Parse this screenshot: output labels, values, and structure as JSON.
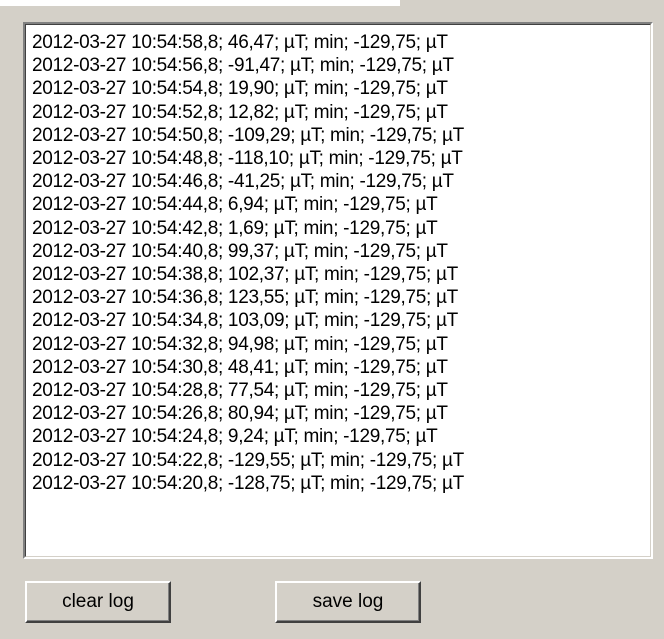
{
  "log": {
    "lines": [
      "2012-03-27 10:54:58,8; 46,47; µT; min; -129,75; µT",
      "2012-03-27 10:54:56,8; -91,47; µT; min; -129,75; µT",
      "2012-03-27 10:54:54,8; 19,90; µT; min; -129,75; µT",
      "2012-03-27 10:54:52,8; 12,82; µT; min; -129,75; µT",
      "2012-03-27 10:54:50,8; -109,29; µT; min; -129,75; µT",
      "2012-03-27 10:54:48,8; -118,10; µT; min; -129,75; µT",
      "2012-03-27 10:54:46,8; -41,25; µT; min; -129,75; µT",
      "2012-03-27 10:54:44,8; 6,94; µT; min; -129,75; µT",
      "2012-03-27 10:54:42,8; 1,69; µT; min; -129,75; µT",
      "2012-03-27 10:54:40,8; 99,37; µT; min; -129,75; µT",
      "2012-03-27 10:54:38,8; 102,37; µT; min; -129,75; µT",
      "2012-03-27 10:54:36,8; 123,55; µT; min; -129,75; µT",
      "2012-03-27 10:54:34,8; 103,09; µT; min; -129,75; µT",
      "2012-03-27 10:54:32,8; 94,98; µT; min; -129,75; µT",
      "2012-03-27 10:54:30,8; 48,41; µT; min; -129,75; µT",
      "2012-03-27 10:54:28,8; 77,54; µT; min; -129,75; µT",
      "2012-03-27 10:54:26,8; 80,94; µT; min; -129,75; µT",
      "2012-03-27 10:54:24,8; 9,24; µT; min; -129,75; µT",
      "2012-03-27 10:54:22,8; -129,55; µT; min; -129,75; µT",
      "2012-03-27 10:54:20,8; -128,75; µT; min; -129,75; µT"
    ]
  },
  "buttons": {
    "clear_label": "clear log",
    "save_label": "save log"
  }
}
